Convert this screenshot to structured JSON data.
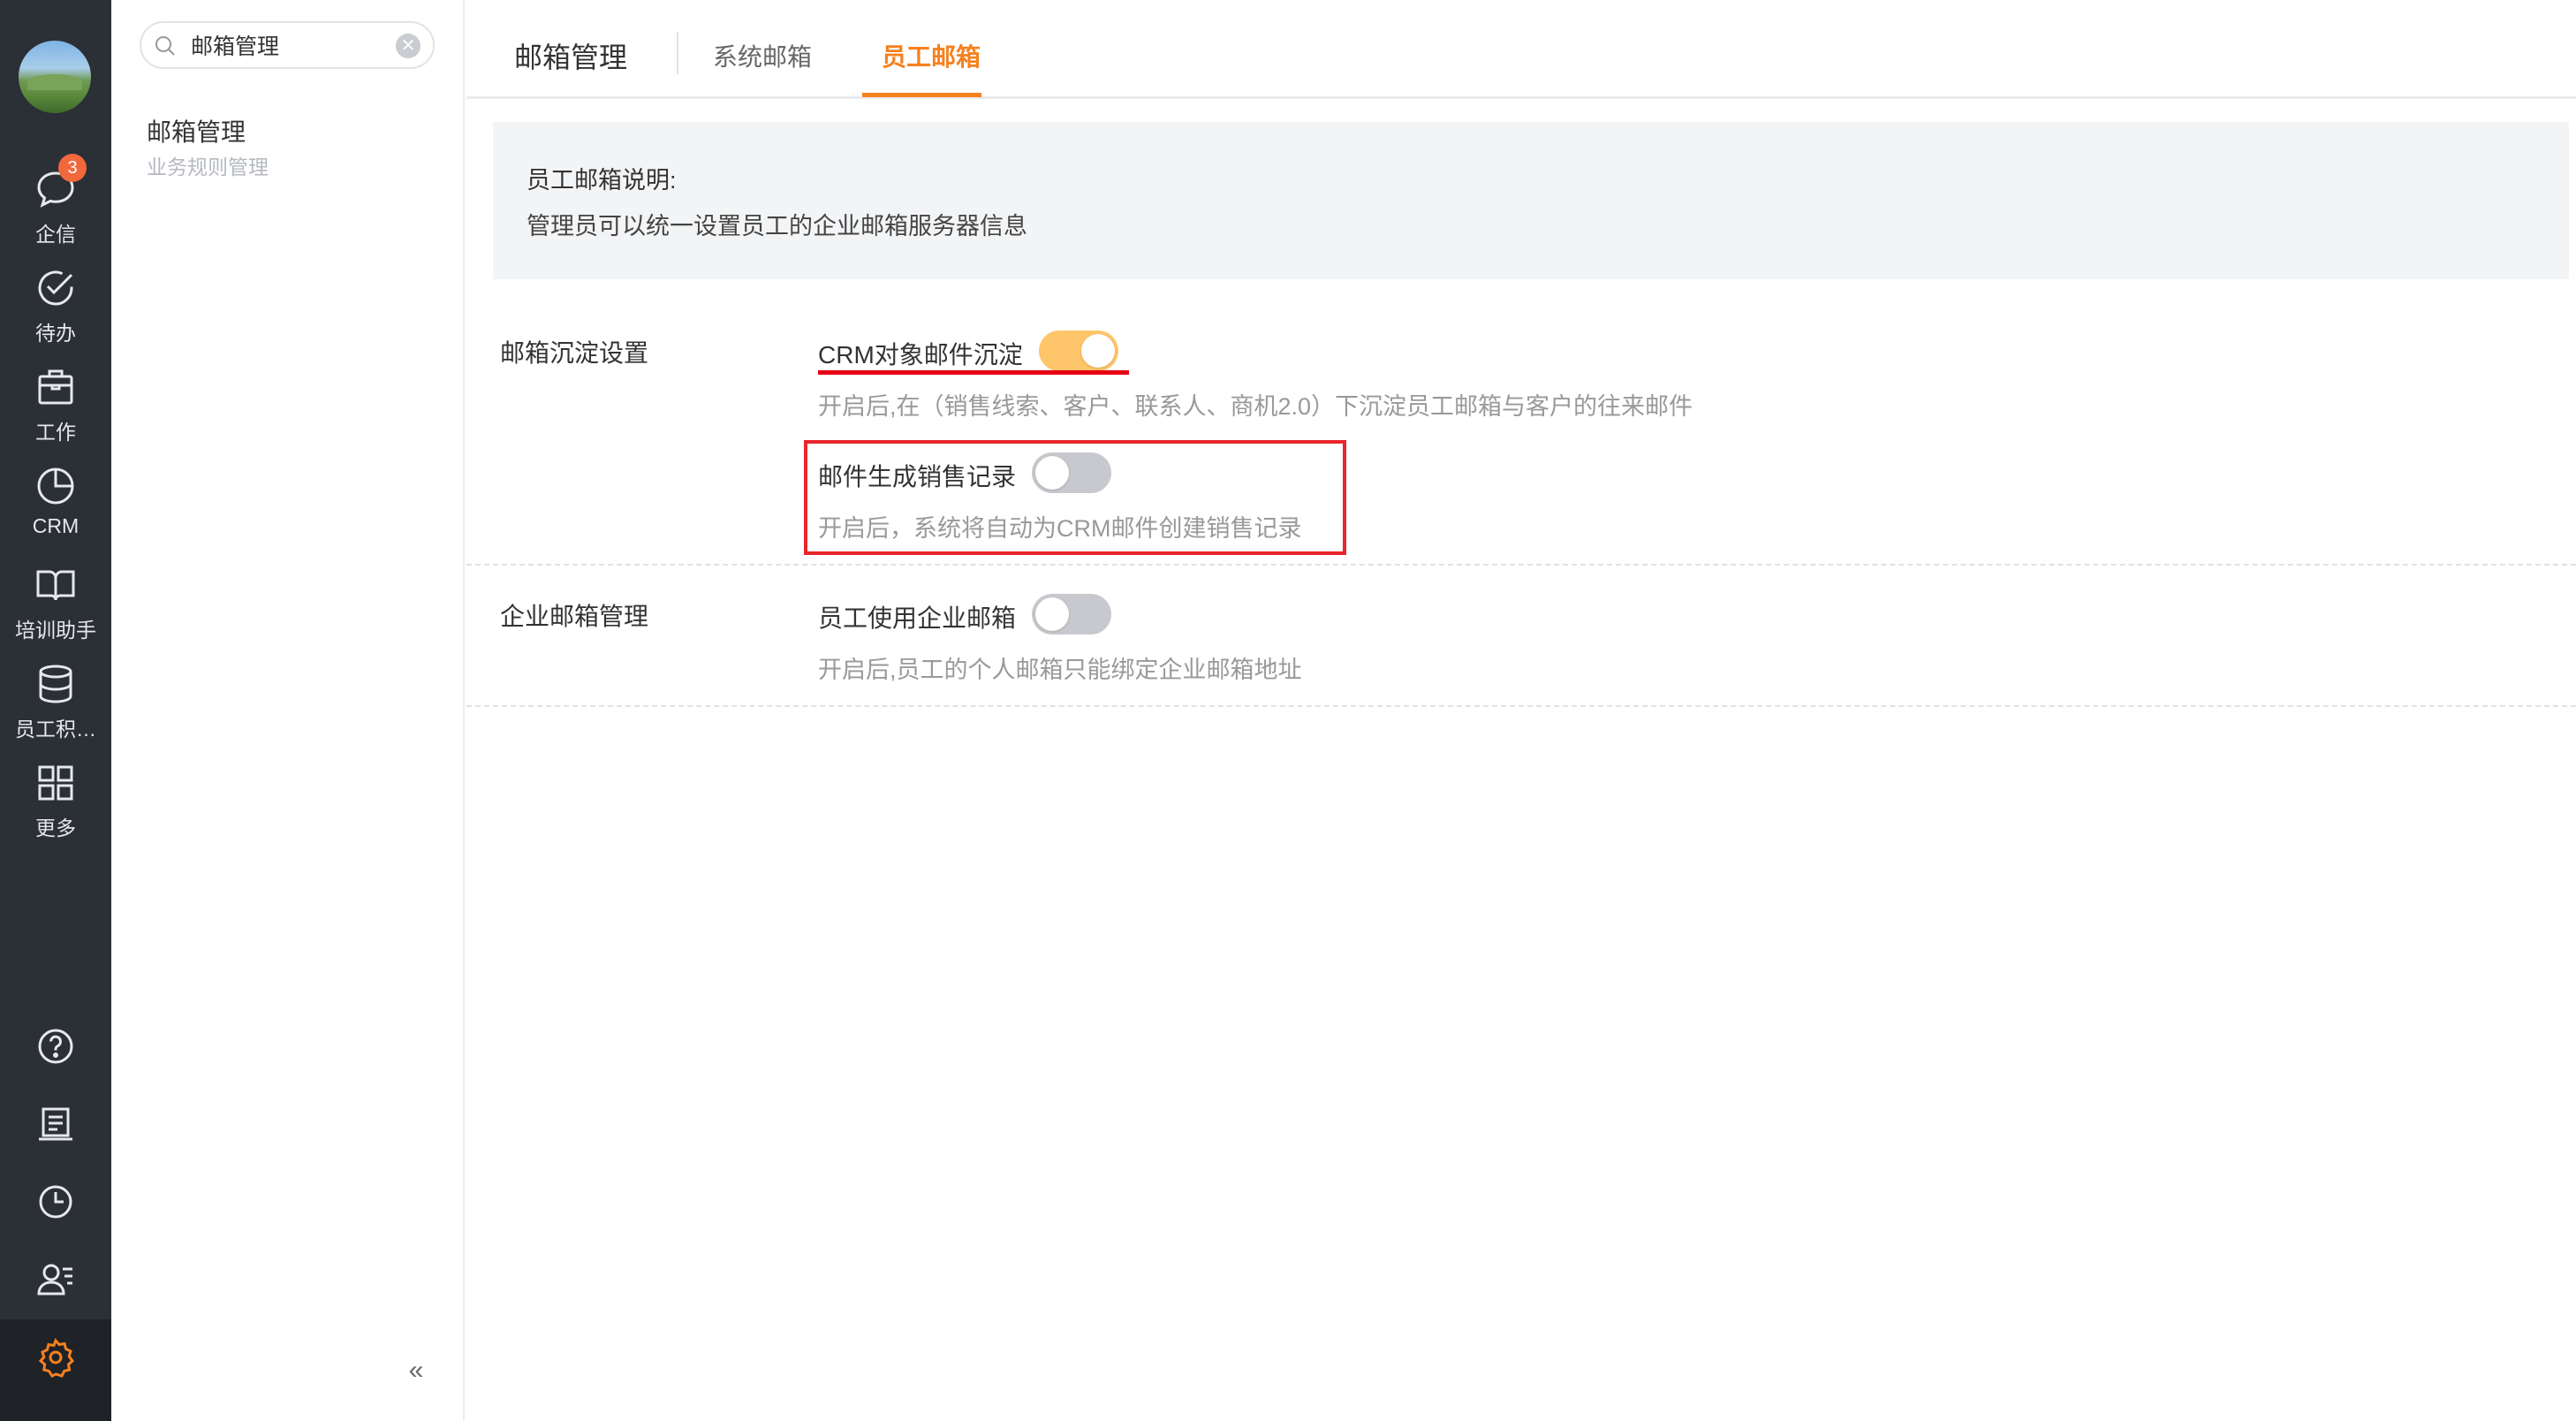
{
  "sidebar": {
    "items": [
      {
        "label": "企信",
        "icon": "chat-bubble-icon",
        "badge": "3"
      },
      {
        "label": "待办",
        "icon": "check-circle-icon"
      },
      {
        "label": "工作",
        "icon": "briefcase-icon"
      },
      {
        "label": "CRM",
        "icon": "pie-chart-icon"
      },
      {
        "label": "培训助手",
        "icon": "open-book-icon"
      },
      {
        "label": "员工积…",
        "icon": "database-icon"
      },
      {
        "label": "更多",
        "icon": "grid-icon"
      }
    ],
    "bottom_icons": [
      "help-icon",
      "notepad-icon",
      "clock-icon",
      "contacts-icon",
      "settings-gear-icon"
    ],
    "accent_color": "#f5811f"
  },
  "subpanel": {
    "search": {
      "value": "邮箱管理"
    },
    "menu_title": "邮箱管理",
    "menu_subtitle": "业务规则管理",
    "collapse_label": "«"
  },
  "header": {
    "title": "邮箱管理",
    "tabs": [
      {
        "label": "系统邮箱",
        "active": false
      },
      {
        "label": "员工邮箱",
        "active": true
      }
    ]
  },
  "notice": {
    "title": "员工邮箱说明:",
    "text": "管理员可以统一设置员工的企业邮箱服务器信息"
  },
  "sections": [
    {
      "label": "邮箱沉淀设置",
      "settings": [
        {
          "label": "CRM对象邮件沉淀",
          "enabled": true,
          "desc": "开启后,在（销售线索、客户、联系人、商机2.0）下沉淀员工邮箱与客户的往来邮件"
        },
        {
          "label": "邮件生成销售记录",
          "enabled": false,
          "desc": "开启后，系统将自动为CRM邮件创建销售记录"
        }
      ]
    },
    {
      "label": "企业邮箱管理",
      "settings": [
        {
          "label": "员工使用企业邮箱",
          "enabled": false,
          "desc": "开启后,员工的个人邮箱只能绑定企业邮箱地址"
        }
      ]
    }
  ]
}
